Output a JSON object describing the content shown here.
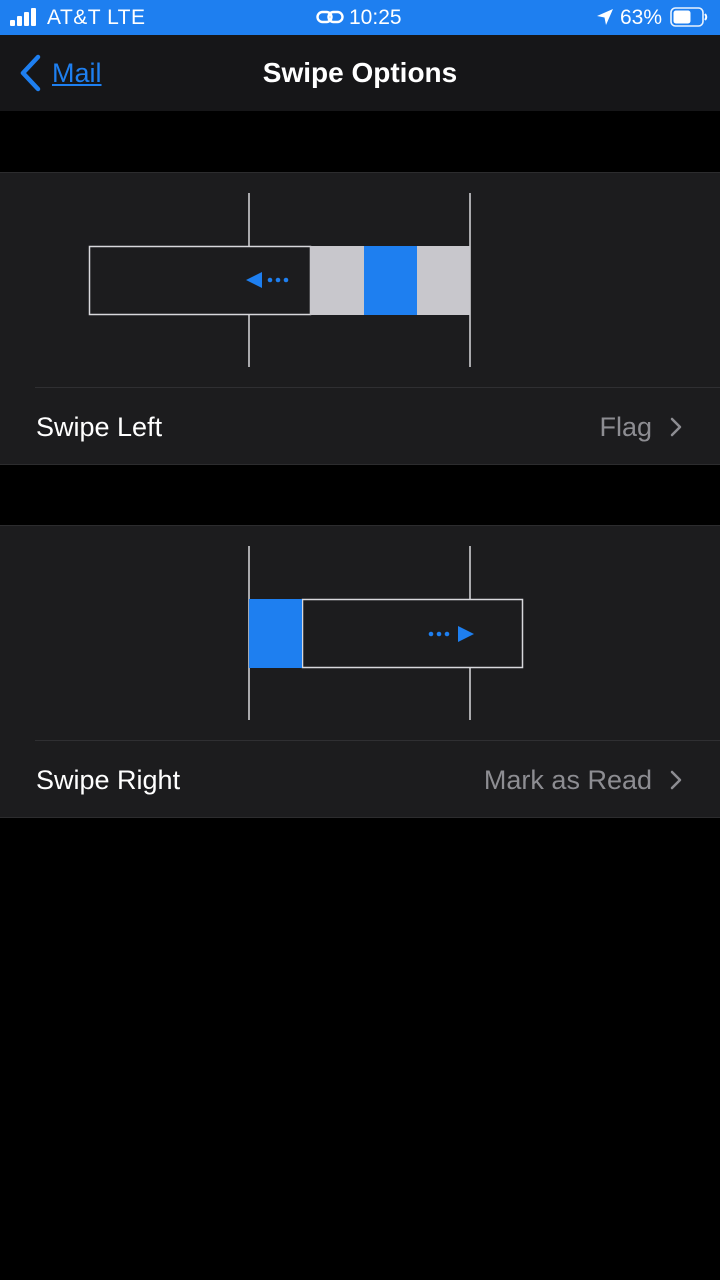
{
  "status_bar": {
    "carrier": "AT&T  LTE",
    "time": "10:25",
    "battery_percent": "63%",
    "battery_level": 0.63,
    "signal_bars": 4
  },
  "nav": {
    "back_label": "Mail",
    "title": "Swipe Options"
  },
  "swipe_left": {
    "label": "Swipe Left",
    "value": "Flag"
  },
  "swipe_right": {
    "label": "Swipe Right",
    "value": "Mark as Read"
  },
  "colors": {
    "accent": "#1e7ff0",
    "background": "#000000",
    "group_background": "#1c1c1e",
    "secondary_text": "#8d8d92",
    "action_gray": "#c8c7cc"
  },
  "icons": {
    "signal": "cellular-signal-icon",
    "link": "link-icon",
    "location": "location-arrow-icon",
    "battery": "battery-icon",
    "back": "chevron-left-icon",
    "disclosure": "chevron-right-icon"
  }
}
